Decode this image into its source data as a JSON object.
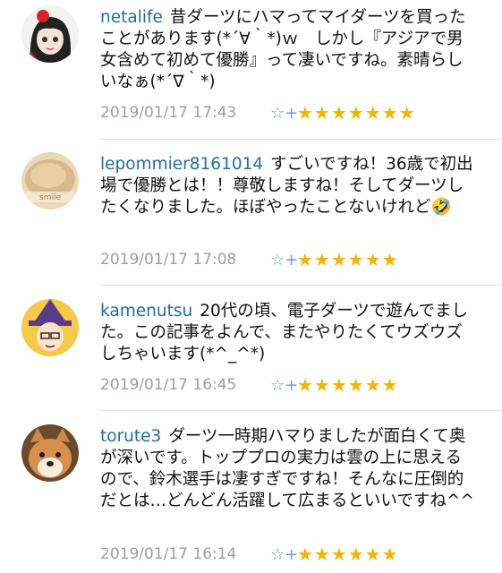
{
  "comments": [
    {
      "user": "netalife",
      "text": "昔ダーツにハマってマイダーツを買ったことがあります(*´∀｀*)ｗ　しかし『アジアで男女含めて初めて優勝』って凄いですね。素晴らしいなぁ(*´∇｀*)",
      "time": "2019/01/17 17:43",
      "star_icon": "☆+",
      "stars_text": "★★★★★★★",
      "star_count": 7,
      "avatar": "anime-girl-avatar"
    },
    {
      "user": "lepommier8161014",
      "text": "すごいですね！36歳で初出場で優勝とは！！尊敬しますね！そしてダーツしたくなりました。ほぼやったことないけれど🤣",
      "time": "2019/01/17 17:08",
      "star_icon": "☆+",
      "stars_text": "★★★★★★",
      "star_count": 6,
      "avatar": "pastry-avatar"
    },
    {
      "user": "kamenutsu",
      "text": "20代の頃、電子ダーツで遊んでました。この記事をよんで、またやりたくてウズウズしちゃいます(*^_^*)",
      "time": "2019/01/17 16:45",
      "star_icon": "☆+",
      "stars_text": "★★★★★★",
      "star_count": 6,
      "avatar": "witch-character-avatar"
    },
    {
      "user": "torute3",
      "text": "ダーツ一時期ハマりましたが面白くて奥が深いです。トッププロの実力は雲の上に思えるので、鈴木選手は凄すぎですね！そんなに圧倒的だとは…どんどん活躍して広まるといいですね^^",
      "time": "2019/01/17 16:14",
      "star_icon": "☆+",
      "stars_text": "★★★★★★",
      "star_count": 6,
      "avatar": "shiba-dog-avatar"
    }
  ]
}
